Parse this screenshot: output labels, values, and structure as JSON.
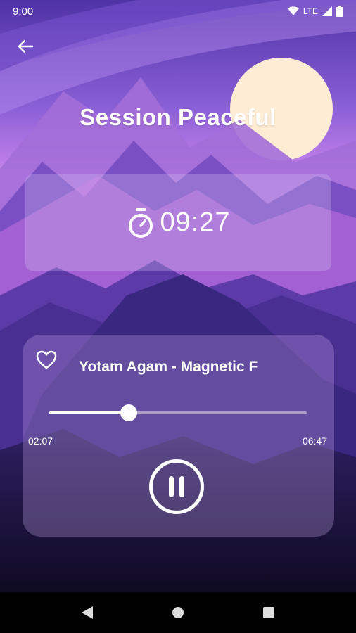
{
  "status_bar": {
    "time": "9:00",
    "network": "LTE"
  },
  "session": {
    "title": "Session Peaceful",
    "timer": "09:27"
  },
  "player": {
    "track_title": "Yotam Agam - Magnetic F",
    "elapsed": "02:07",
    "duration": "06:47",
    "progress_fraction": 0.31,
    "state": "playing"
  },
  "icons": {
    "back": "arrow-left-icon",
    "timer": "stopwatch-icon",
    "favorite": "heart-outline-icon",
    "pause": "pause-icon",
    "nav_back": "triangle-back-icon",
    "nav_home": "circle-home-icon",
    "nav_recents": "square-recents-icon"
  },
  "colors": {
    "sky_top": "#5a3bb0",
    "sky_mid": "#c77ae8",
    "sun": "#ffecd4",
    "night": "#120d26"
  }
}
